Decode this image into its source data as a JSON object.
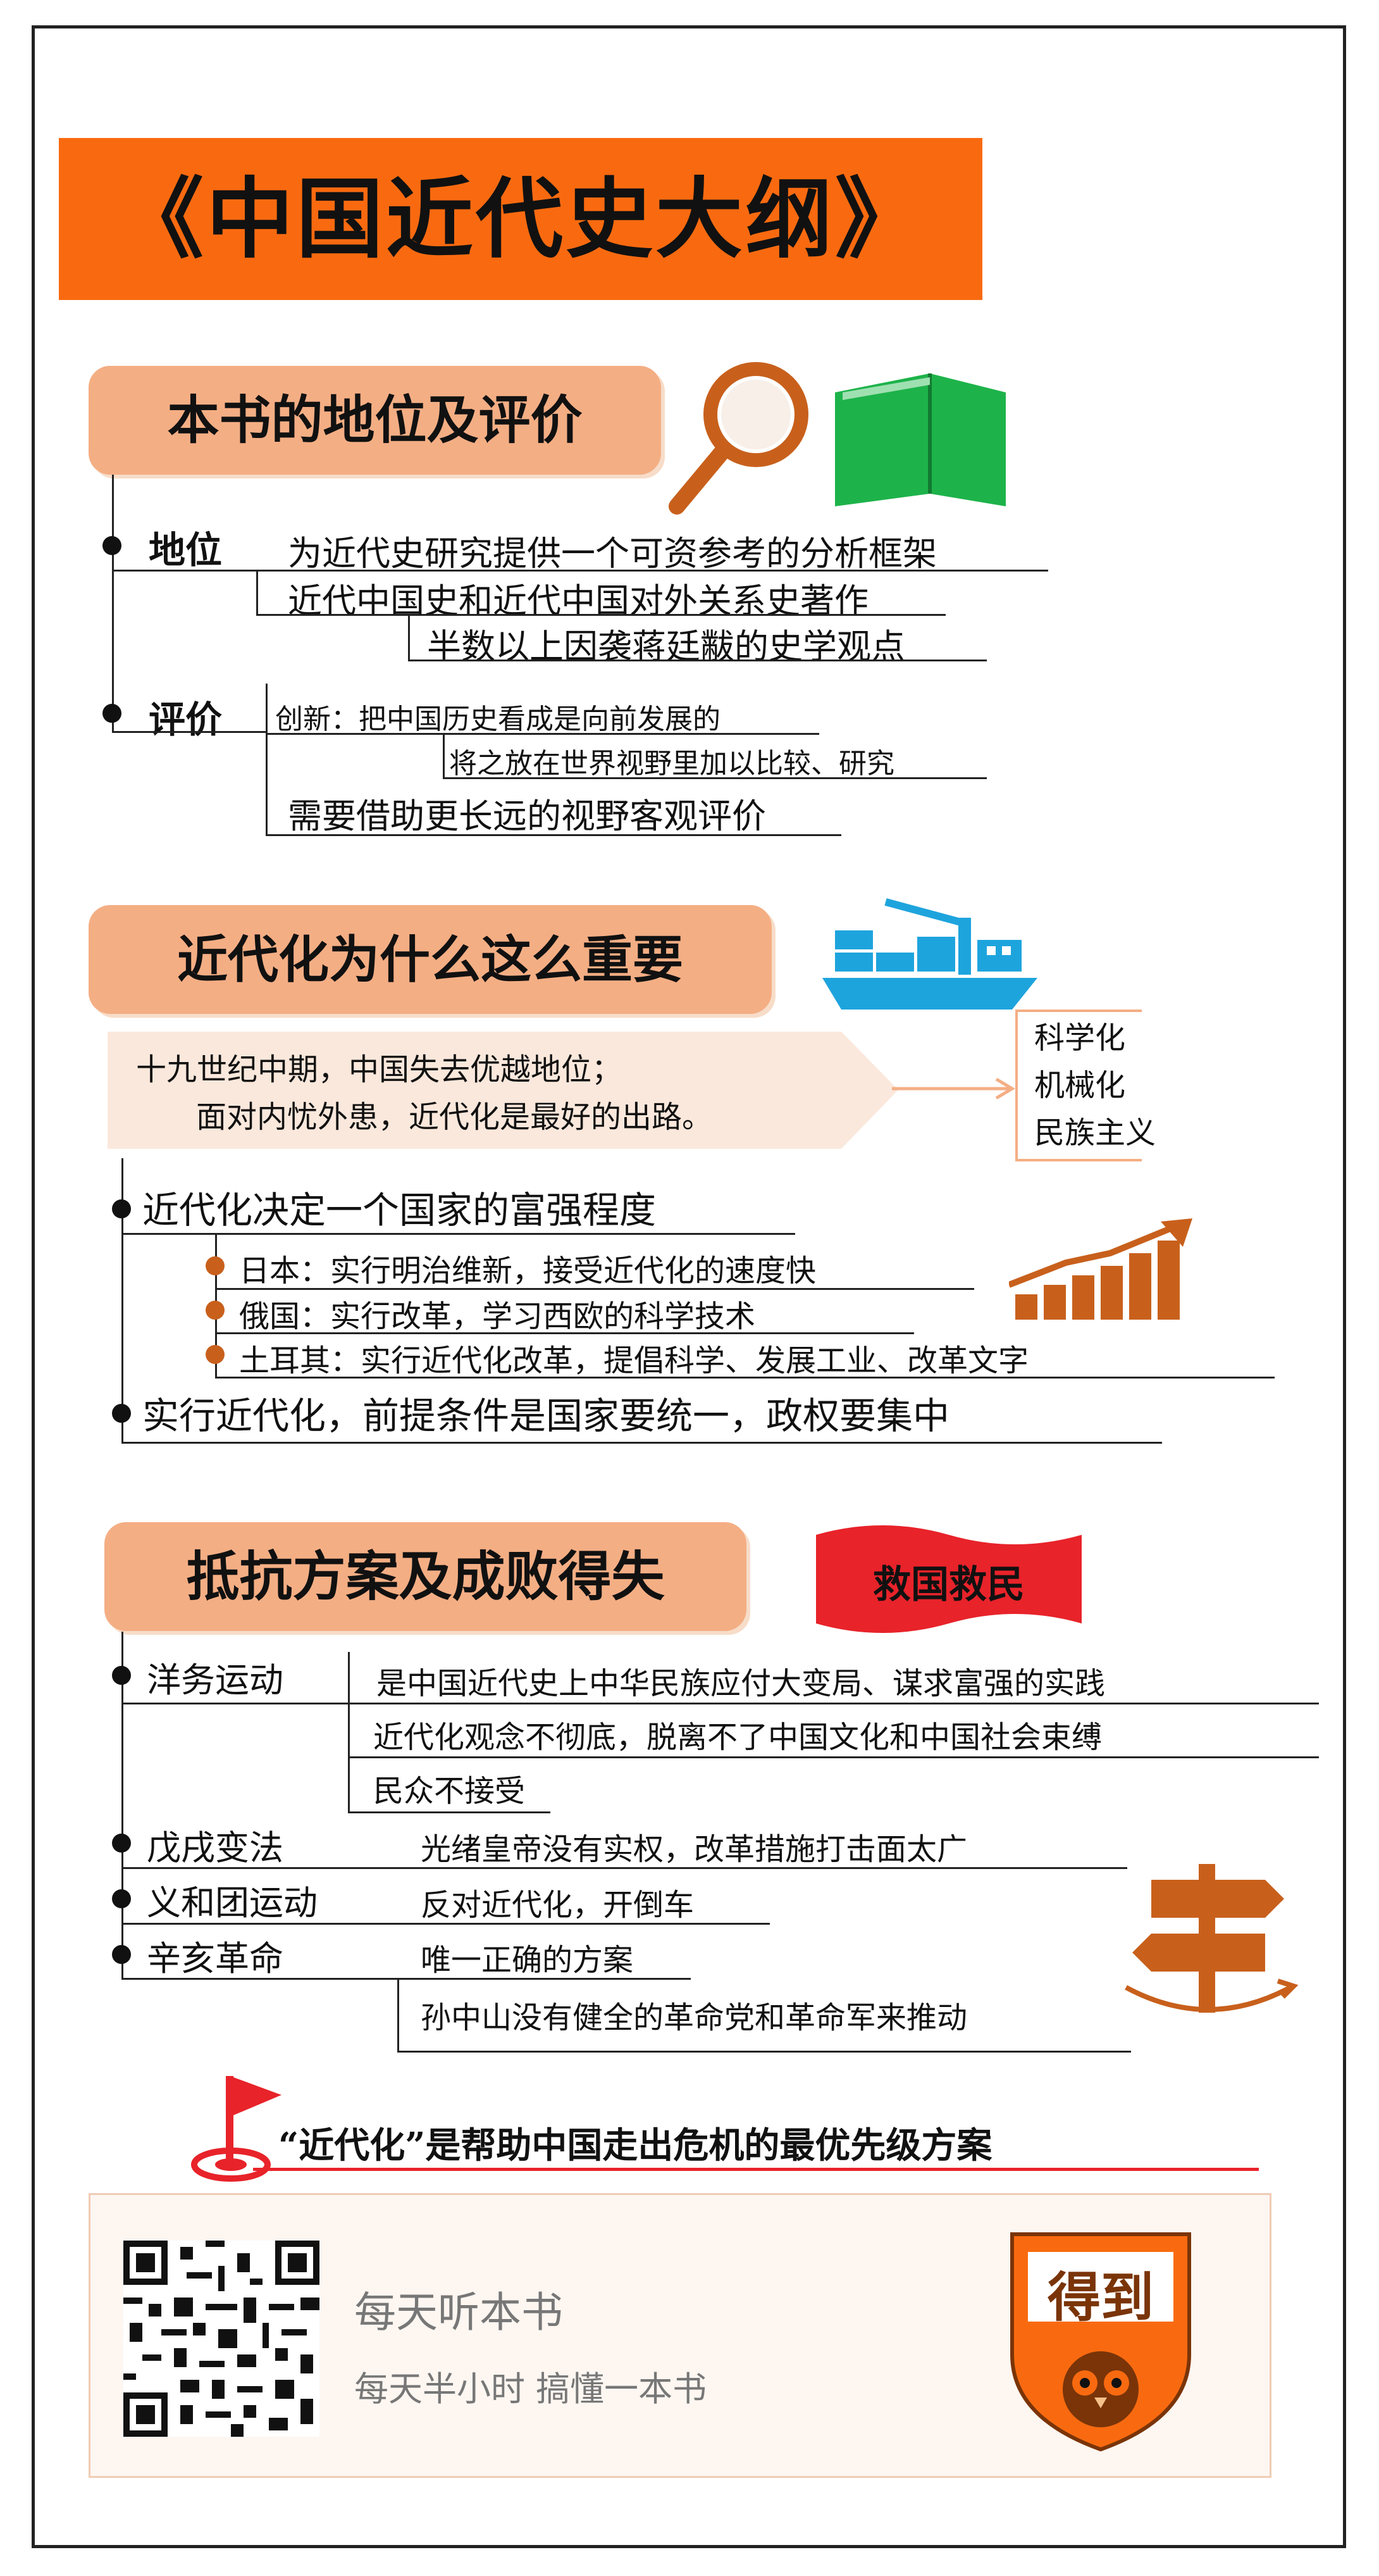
{
  "title": "《中国近代史大纲》",
  "section1": {
    "heading": "本书的地位及评价",
    "position_label": "地位",
    "position_items": [
      "为近代史研究提供一个可资参考的分析框架",
      "近代中国史和近代中国对外关系史著作",
      "半数以上因袭蒋廷黻的史学观点"
    ],
    "evaluation_label": "评价",
    "evaluation_items": [
      "创新：把中国历史看成是向前发展的",
      "将之放在世界视野里加以比较、研究",
      "需要借助更长远的视野客观评价"
    ]
  },
  "section2": {
    "heading": "近代化为什么这么重要",
    "banner_line1": "十九世纪中期，中国失去优越地位；",
    "banner_line2": "面对内忧外患，近代化是最好的出路。",
    "side_items": [
      "科学化",
      "机械化",
      "民族主义"
    ],
    "point1": "近代化决定一个国家的富强程度",
    "sub_items": [
      "日本：实行明治维新，接受近代化的速度快",
      "俄国：实行改革，学习西欧的科学技术",
      "土耳其：实行近代化改革，提倡科学、发展工业、改革文字"
    ],
    "point2": "实行近代化，前提条件是国家要统一，政权要集中"
  },
  "section3": {
    "heading": "抵抗方案及成败得失",
    "flag_text": "救国救民",
    "movements": [
      {
        "name": "洋务运动",
        "notes": [
          "是中国近代史上中华民族应付大变局、谋求富强的实践",
          "近代化观念不彻底，脱离不了中国文化和中国社会束缚",
          "民众不接受"
        ]
      },
      {
        "name": "戊戌变法",
        "notes": [
          "光绪皇帝没有实权，改革措施打击面太广"
        ]
      },
      {
        "name": "义和团运动",
        "notes": [
          "反对近代化，开倒车"
        ]
      },
      {
        "name": "辛亥革命",
        "notes": [
          "唯一正确的方案",
          "孙中山没有健全的革命党和革命军来推动"
        ]
      }
    ]
  },
  "conclusion": "“近代化”是帮助中国走出危机的最优先级方案",
  "footer": {
    "line1": "每天听本书",
    "line2": "每天半小时  搞懂一本书",
    "logo_text": "得到"
  },
  "colors": {
    "orange": "#f96a10",
    "peach": "#f4ae84",
    "dark_orange": "#c8601c",
    "red": "#e8232a",
    "green": "#1db34a",
    "blue": "#1ea4dd"
  }
}
